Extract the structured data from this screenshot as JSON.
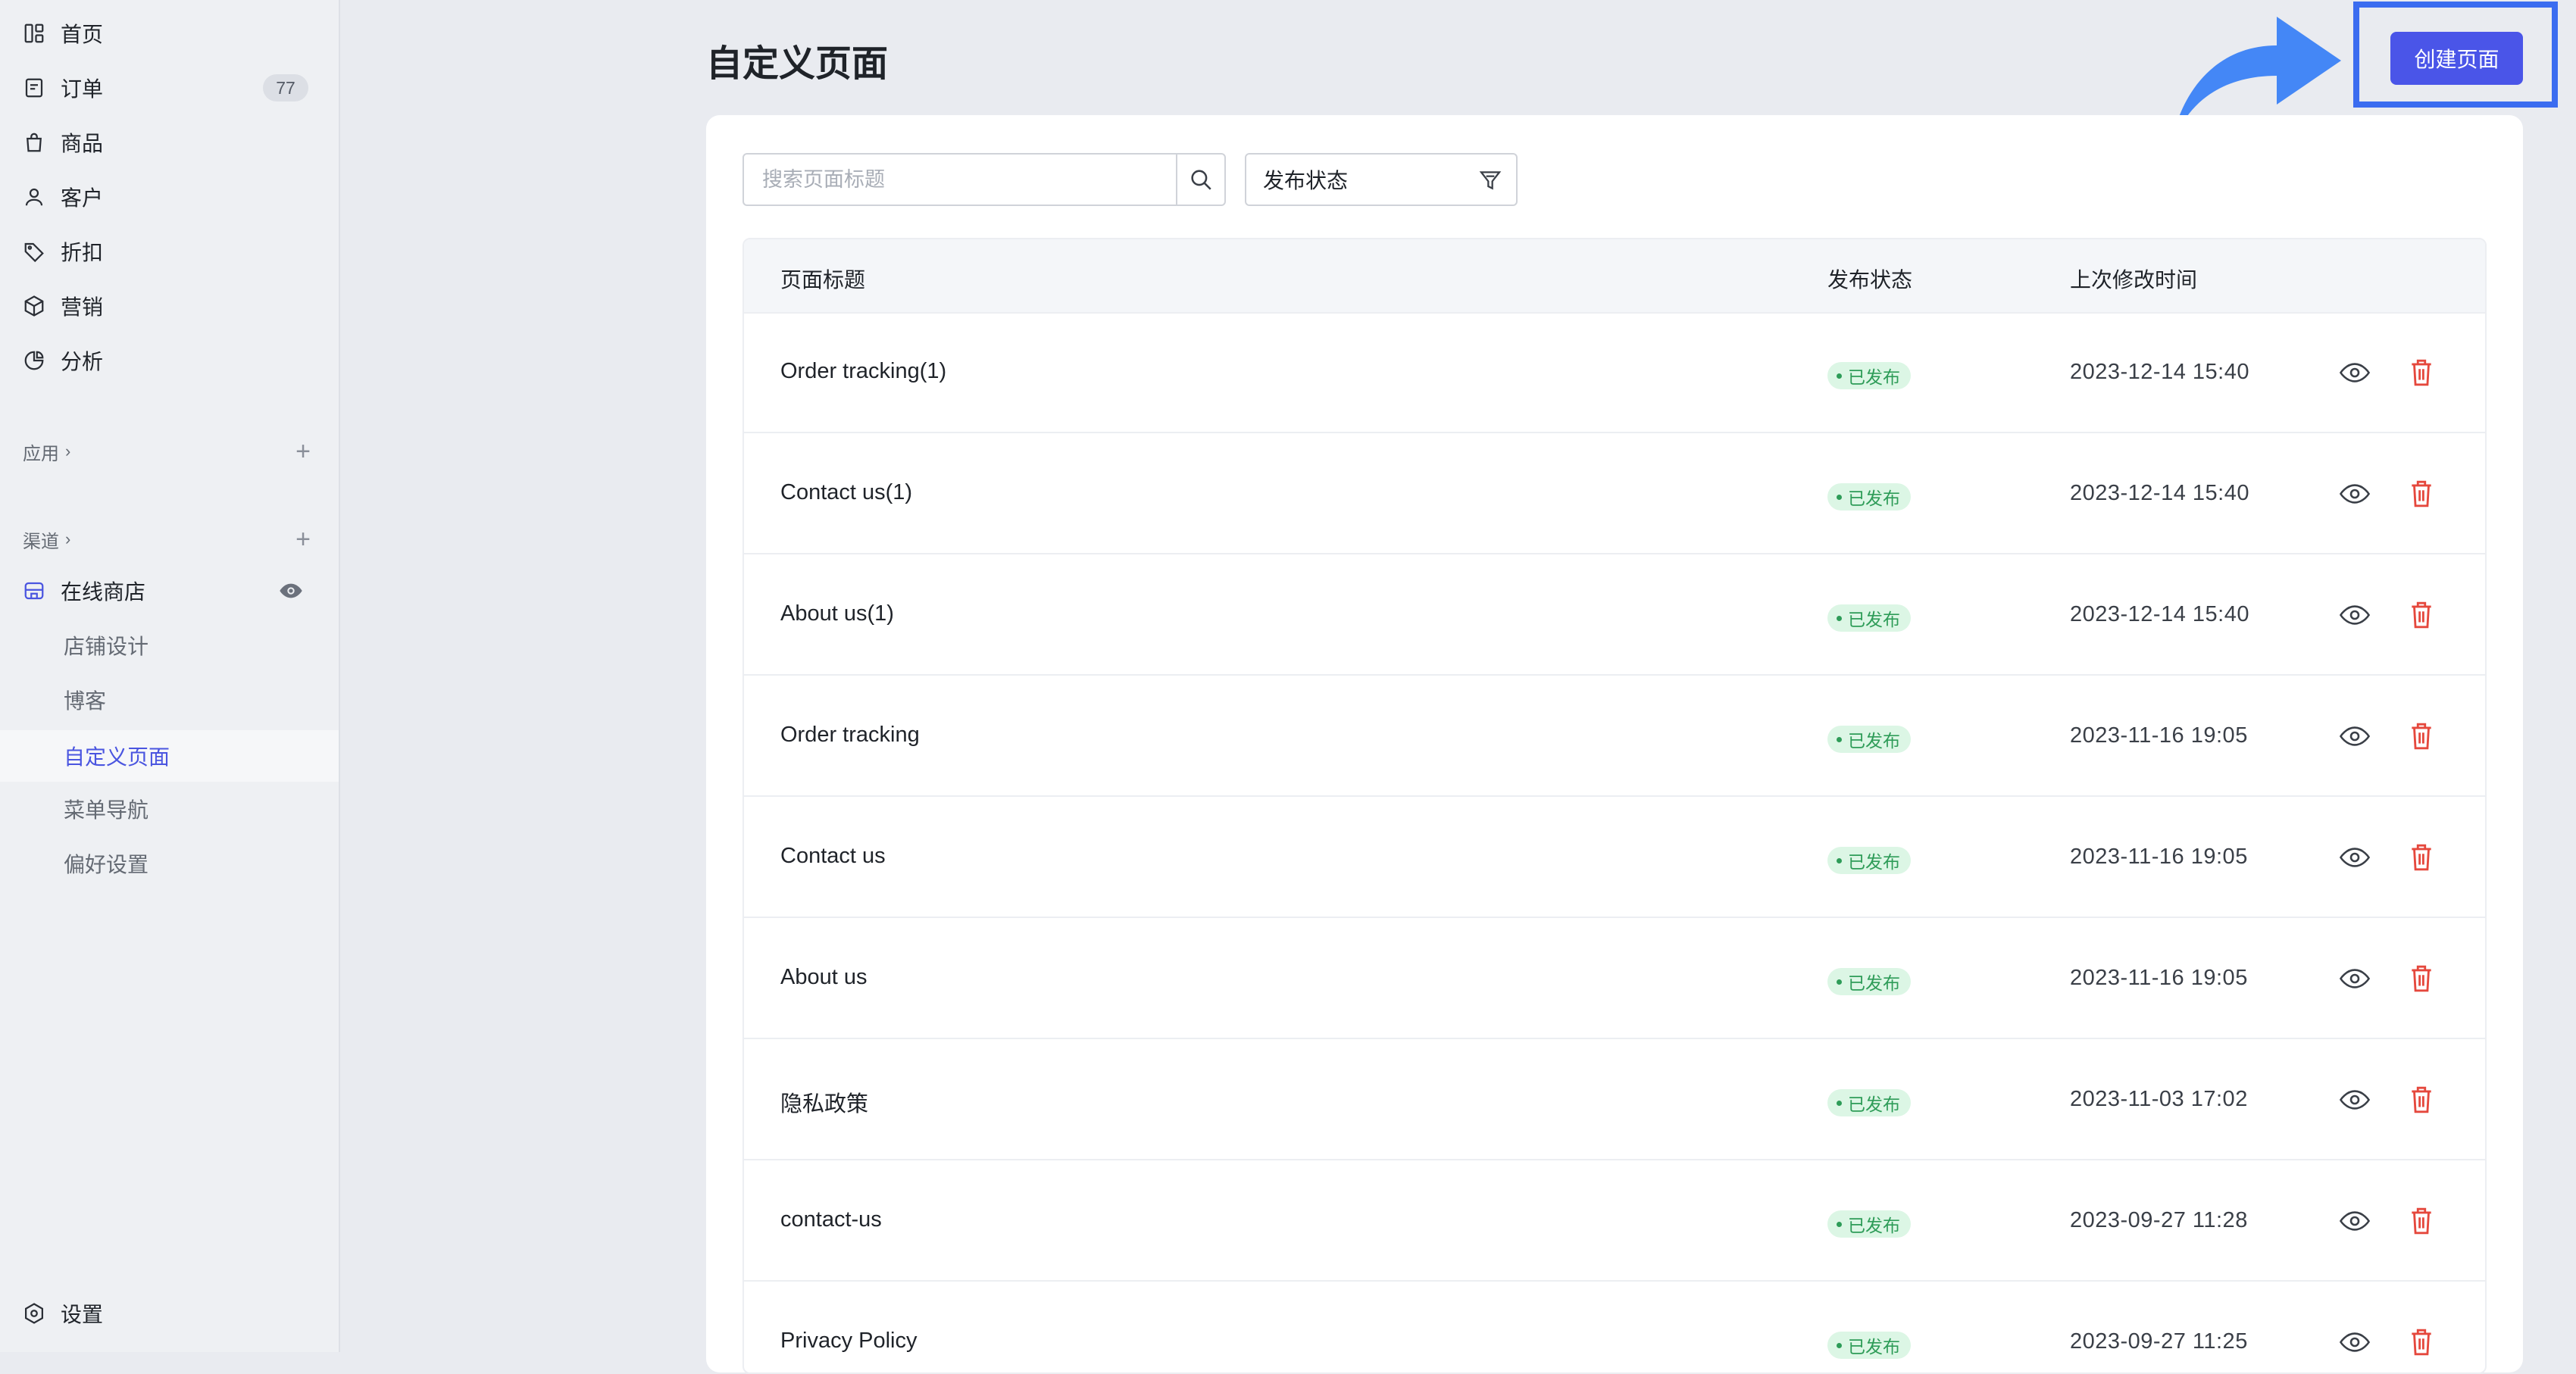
{
  "sidebar": {
    "nav": [
      {
        "label": "首页",
        "icon": "home-icon"
      },
      {
        "label": "订单",
        "icon": "order-icon",
        "badge": "77"
      },
      {
        "label": "商品",
        "icon": "bag-icon"
      },
      {
        "label": "客户",
        "icon": "user-icon"
      },
      {
        "label": "折扣",
        "icon": "tag-icon"
      },
      {
        "label": "营销",
        "icon": "box-icon"
      },
      {
        "label": "分析",
        "icon": "pie-icon"
      }
    ],
    "apps_label": "应用",
    "channels_label": "渠道",
    "online_store": "在线商店",
    "sub_items": [
      "店铺设计",
      "博客",
      "自定义页面",
      "菜单导航",
      "偏好设置"
    ],
    "active_sub": "自定义页面",
    "settings_label": "设置"
  },
  "page": {
    "title": "自定义页面",
    "create_button": "创建页面",
    "search_placeholder": "搜索页面标题",
    "filter_label": "发布状态"
  },
  "table": {
    "headers": [
      "页面标题",
      "发布状态",
      "上次修改时间"
    ],
    "rows": [
      {
        "title": "Order tracking(1)",
        "status": "已发布",
        "time": "2023-12-14 15:40"
      },
      {
        "title": "Contact us(1)",
        "status": "已发布",
        "time": "2023-12-14 15:40"
      },
      {
        "title": "About us(1)",
        "status": "已发布",
        "time": "2023-12-14 15:40"
      },
      {
        "title": "Order tracking",
        "status": "已发布",
        "time": "2023-11-16 19:05"
      },
      {
        "title": "Contact us",
        "status": "已发布",
        "time": "2023-11-16 19:05"
      },
      {
        "title": "About us",
        "status": "已发布",
        "time": "2023-11-16 19:05"
      },
      {
        "title": "隐私政策",
        "status": "已发布",
        "time": "2023-11-03 17:02"
      },
      {
        "title": "contact-us",
        "status": "已发布",
        "time": "2023-09-27 11:28"
      },
      {
        "title": "Privacy Policy",
        "status": "已发布",
        "time": "2023-09-27 11:25"
      }
    ]
  },
  "colors": {
    "accent": "#4a55e8",
    "highlight_border": "#3b6cf0",
    "published_bg": "#dcf6e5",
    "published_text": "#2e9c58",
    "delete_red": "#e5483d"
  }
}
